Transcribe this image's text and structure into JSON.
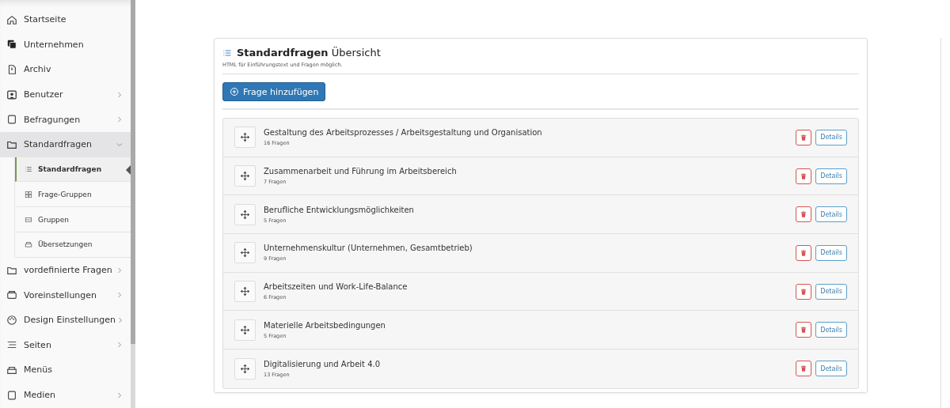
{
  "sidebar": {
    "items": [
      {
        "label": "Startseite",
        "has_children": false,
        "selected": false
      },
      {
        "label": "Unternehmen",
        "has_children": false,
        "selected": false
      },
      {
        "label": "Archiv",
        "has_children": false,
        "selected": false
      },
      {
        "label": "Benutzer",
        "has_children": true,
        "expanded": false,
        "selected": false
      },
      {
        "label": "Befragungen",
        "has_children": true,
        "expanded": false,
        "selected": false
      },
      {
        "label": "Standardfragen",
        "has_children": true,
        "expanded": true,
        "selected": true,
        "children": [
          {
            "label": "Standardfragen",
            "selected": true
          },
          {
            "label": "Frage-Gruppen",
            "selected": false
          },
          {
            "label": "Gruppen",
            "selected": false
          },
          {
            "label": "Übersetzungen",
            "selected": false
          }
        ]
      },
      {
        "label": "vordefinierte Fragen",
        "has_children": true,
        "expanded": false,
        "selected": false
      },
      {
        "label": "Voreinstellungen",
        "has_children": true,
        "expanded": false,
        "selected": false
      },
      {
        "label": "Design Einstellungen",
        "has_children": true,
        "expanded": false,
        "selected": false
      },
      {
        "label": "Seiten",
        "has_children": true,
        "expanded": false,
        "selected": false
      },
      {
        "label": "Menüs",
        "has_children": false,
        "selected": false
      },
      {
        "label": "Medien",
        "has_children": true,
        "expanded": false,
        "selected": false
      }
    ]
  },
  "panel": {
    "title": "**Standardfragen** Übersicht",
    "subtitle": "HTML für Einführungstext und Fragen möglich.",
    "add_button": "Frage hinzufügen",
    "groups": [
      {
        "title": "Gestaltung des Arbeitsprozesses / Arbeitsgestaltung und Organisation",
        "count": "16 Fragen",
        "details": "Details"
      },
      {
        "title": "Zusammenarbeit und Führung im Arbeitsbereich",
        "count": "7 Fragen",
        "details": "Details"
      },
      {
        "title": "Berufliche Entwicklungsmöglichkeiten",
        "count": "5 Fragen",
        "details": "Details"
      },
      {
        "title": "Unternehmenskultur (Unternehmen, Gesamtbetrieb)",
        "count": "9 Fragen",
        "details": "Details"
      },
      {
        "title": "Arbeitszeiten und Work-Life-Balance",
        "count": "6 Fragen",
        "details": "Details"
      },
      {
        "title": "Materielle Arbeitsbedingungen",
        "count": "5 Fragen",
        "details": "Details"
      },
      {
        "title": "Digitalisierung und Arbeit 4.0",
        "count": "13 Fragen",
        "details": "Details"
      }
    ]
  }
}
